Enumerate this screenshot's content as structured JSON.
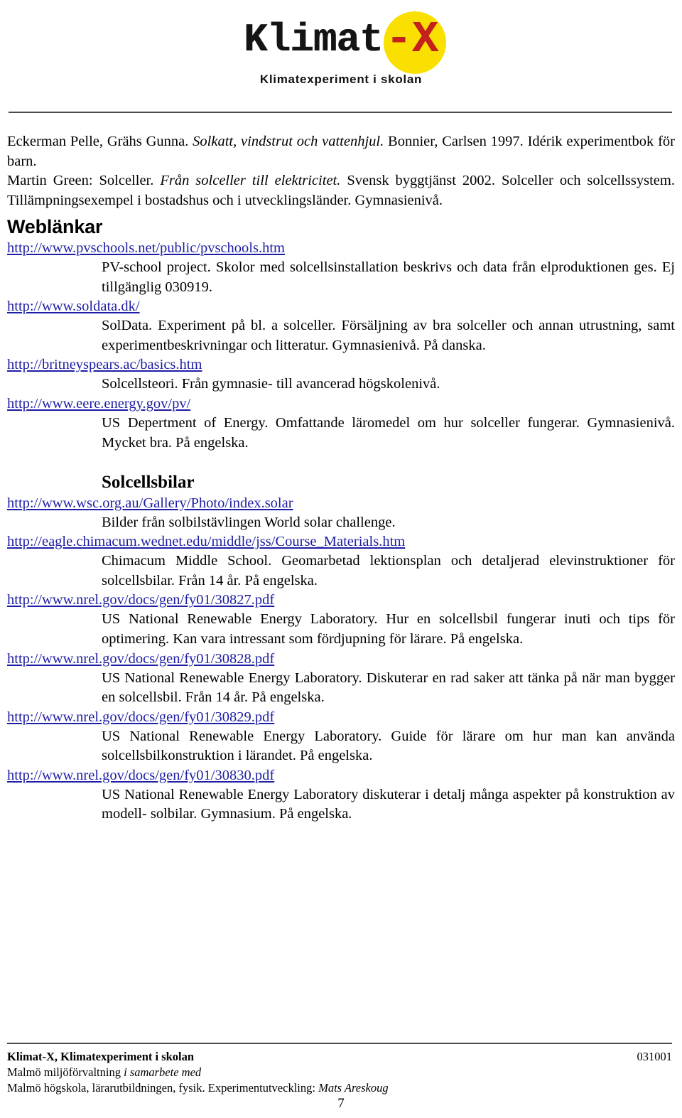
{
  "logo": {
    "wordmark_main": "Klimat",
    "wordmark_x": "X",
    "wordmark_dash": "-",
    "tagline": "Klimatexperiment i skolan",
    "sun_color": "#FAE000",
    "x_color": "#C4201C"
  },
  "references": [
    {
      "parts": [
        {
          "text": "Eckerman Pelle, Grähs Gunna. ",
          "style": "normal"
        },
        {
          "text": "Solkatt, vindstrut och vattenhjul.",
          "style": "italic"
        },
        {
          "text": " Bonnier, Carlsen 1997. Idérik experimentbok för barn.",
          "style": "normal"
        }
      ]
    },
    {
      "parts": [
        {
          "text": "Martin Green: Solceller. ",
          "style": "normal"
        },
        {
          "text": "Från solceller till elektricitet.",
          "style": "italic"
        },
        {
          "text": " Svensk byggtjänst 2002. Solceller och solcellssystem. Tillämpningsexempel i bostadshus och i utvecklingsländer. Gymnasienivå.",
          "style": "normal"
        }
      ]
    }
  ],
  "sections": [
    {
      "heading": "Weblänkar",
      "heading_style": "sans-bold",
      "links": [
        {
          "url": "http://www.pvschools.net/public/pvschools.htm",
          "description": "PV-school project. Skolor med solcellsinstallation beskrivs och data från elproduktionen ges. Ej tillgänglig 030919."
        },
        {
          "url": "http://www.soldata.dk/",
          "description": "SolData. Experiment på bl. a solceller. Försäljning av bra solceller och annan utrustning, samt experimentbeskrivningar och litteratur. Gymnasienivå. På danska."
        },
        {
          "url": "http://britneyspears.ac/basics.htm",
          "description": "Solcellsteori. Från gymnasie- till avancerad högskolenivå."
        },
        {
          "url": "http://www.eere.energy.gov/pv/",
          "description": "US Depertment of Energy. Omfattande läromedel om hur solceller fungerar. Gymnasienivå. Mycket bra. På engelska."
        }
      ]
    },
    {
      "heading": "Solcellsbilar",
      "heading_style": "serif-bold",
      "links": [
        {
          "url": "http://www.wsc.org.au/Gallery/Photo/index.solar",
          "description": "Bilder från solbilstävlingen World solar challenge."
        },
        {
          "url": "http://eagle.chimacum.wednet.edu/middle/jss/Course_Materials.htm",
          "description": "Chimacum Middle School. Geomarbetad lektionsplan och detaljerad elevinstruktioner för solcellsbilar. Från 14 år. På engelska."
        },
        {
          "url": "http://www.nrel.gov/docs/gen/fy01/30827.pdf",
          "description": "US National Renewable Energy Laboratory. Hur en solcellsbil fungerar inuti och tips för optimering. Kan vara intressant som fördjupning för lärare. På engelska."
        },
        {
          "url": "http://www.nrel.gov/docs/gen/fy01/30828.pdf",
          "description": "US National Renewable Energy Laboratory. Diskuterar en rad saker att tänka på när man bygger en solcellsbil. Från 14 år. På engelska."
        },
        {
          "url": "http://www.nrel.gov/docs/gen/fy01/30829.pdf",
          "description": "US National Renewable Energy Laboratory. Guide för lärare om hur man kan använda solcellsbilkonstruktion i lärandet. På engelska."
        },
        {
          "url": "http://www.nrel.gov/docs/gen/fy01/30830.pdf",
          "description": "US National Renewable Energy Laboratory diskuterar i detalj många aspekter på konstruktion av modell- solbilar. Gymnasium. På engelska."
        }
      ]
    }
  ],
  "footer": {
    "title": "Klimat-X, Klimatexperiment i skolan",
    "date_code": "031001",
    "line2_normal": "Malmö miljöförvaltning ",
    "line2_italic": "i samarbete med",
    "line3_normal": "Malmö högskola, lärarutbildningen, fysik. Experimentutveckling: ",
    "line3_italic": "Mats Areskoug",
    "page_number": "7"
  },
  "colors": {
    "link": "#1D1DA5",
    "text": "#000000",
    "rule": "#4A4A4A"
  }
}
